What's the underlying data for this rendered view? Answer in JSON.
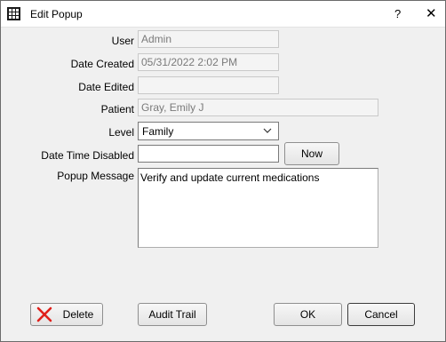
{
  "window": {
    "title": "Edit Popup",
    "help": "?",
    "close": "✕"
  },
  "form": {
    "user_label": "User",
    "user_value": "Admin",
    "date_created_label": "Date Created",
    "date_created_value": "05/31/2022 2:02 PM",
    "date_edited_label": "Date Edited",
    "date_edited_value": "",
    "patient_label": "Patient",
    "patient_value": "Gray, Emily J",
    "level_label": "Level",
    "level_value": "Family",
    "date_time_disabled_label": "Date Time Disabled",
    "date_time_disabled_value": "",
    "now_label": "Now",
    "popup_message_label": "Popup Message",
    "popup_message_value": "Verify and update current medications"
  },
  "footer": {
    "delete_label": "Delete",
    "audit_trail_label": "Audit Trail",
    "ok_label": "OK",
    "cancel_label": "Cancel"
  },
  "colors": {
    "delete_icon": "#e0201b"
  }
}
